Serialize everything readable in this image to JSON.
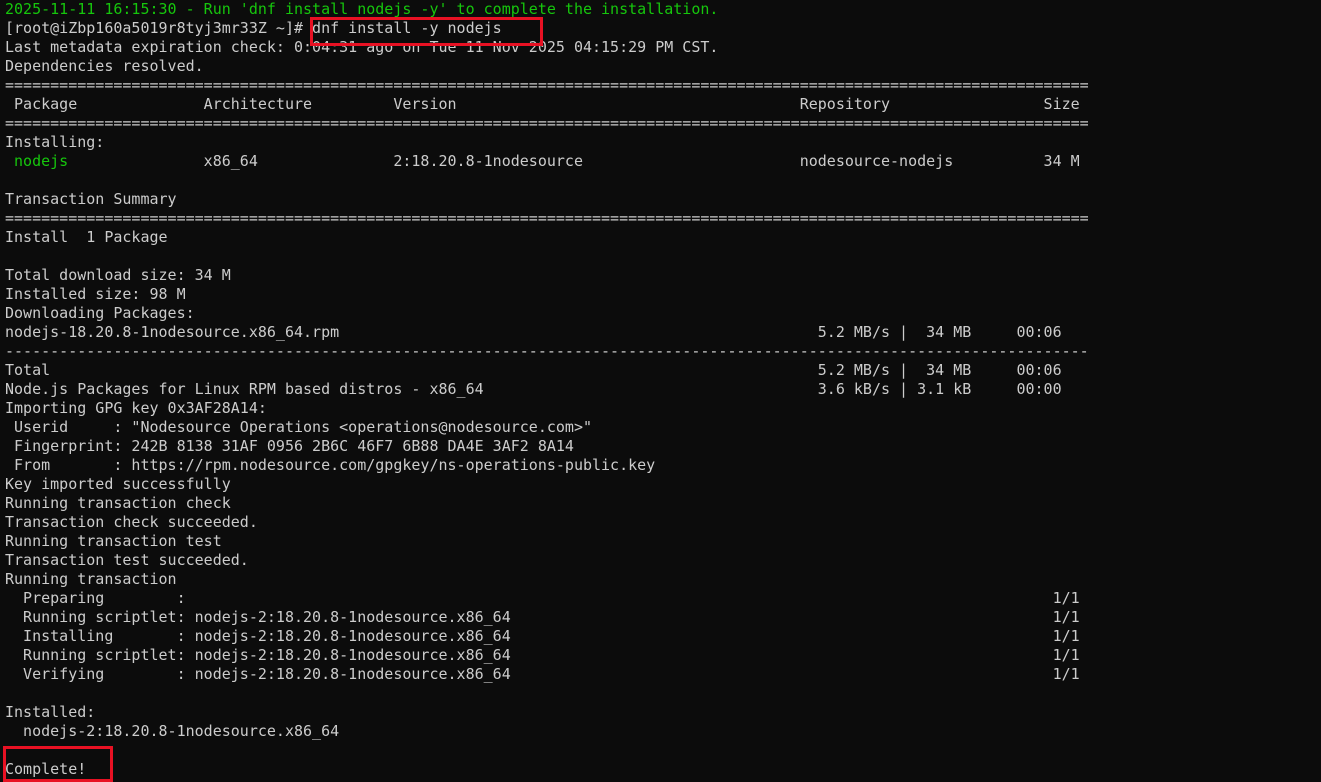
{
  "colors": {
    "background": "#0c0c0c",
    "foreground": "#cccccc",
    "green": "#16c60c",
    "annotation_red": "#e81123"
  },
  "lines": [
    [
      {
        "t": "2025-11-11 16:15:30 - Run 'dnf install nodejs -y' to complete the installation.",
        "c": "green-cmd"
      }
    ],
    [
      {
        "t": "[root@iZbp160a5019r8tyj3mr33Z ~]# "
      },
      {
        "t": "dnf install -y nodejs"
      }
    ],
    [
      {
        "t": "Last metadata expiration check: 0:04:31 ago on Tue 11 Nov 2025 04:15:29 PM CST."
      }
    ],
    [
      {
        "t": "Dependencies resolved."
      }
    ],
    [
      {
        "t": "========================================================================================================================"
      }
    ],
    [
      {
        "t": " Package              Architecture         Version                                      Repository                 Size"
      }
    ],
    [
      {
        "t": "========================================================================================================================"
      }
    ],
    [
      {
        "t": "Installing:"
      }
    ],
    [
      {
        "t": " "
      },
      {
        "t": "nodejs",
        "c": "green-pkg"
      },
      {
        "t": "               x86_64               2:18.20.8-1nodesource                        nodesource-nodejs          34 M"
      }
    ],
    [
      {
        "t": ""
      }
    ],
    [
      {
        "t": "Transaction Summary"
      }
    ],
    [
      {
        "t": "========================================================================================================================"
      }
    ],
    [
      {
        "t": "Install  1 Package"
      }
    ],
    [
      {
        "t": ""
      }
    ],
    [
      {
        "t": "Total download size: 34 M"
      }
    ],
    [
      {
        "t": "Installed size: 98 M"
      }
    ],
    [
      {
        "t": "Downloading Packages:"
      }
    ],
    [
      {
        "t": "nodejs-18.20.8-1nodesource.x86_64.rpm                                                     5.2 MB/s |  34 MB     00:06"
      }
    ],
    [
      {
        "t": "------------------------------------------------------------------------------------------------------------------------"
      }
    ],
    [
      {
        "t": "Total                                                                                     5.2 MB/s |  34 MB     00:06"
      }
    ],
    [
      {
        "t": "Node.js Packages for Linux RPM based distros - x86_64                                     3.6 kB/s | 3.1 kB     00:00"
      }
    ],
    [
      {
        "t": "Importing GPG key 0x3AF28A14:"
      }
    ],
    [
      {
        "t": " Userid     : \"Nodesource Operations <operations@nodesource.com>\""
      }
    ],
    [
      {
        "t": " Fingerprint: 242B 8138 31AF 0956 2B6C 46F7 6B88 DA4E 3AF2 8A14"
      }
    ],
    [
      {
        "t": " From       : https://rpm.nodesource.com/gpgkey/ns-operations-public.key"
      }
    ],
    [
      {
        "t": "Key imported successfully"
      }
    ],
    [
      {
        "t": "Running transaction check"
      }
    ],
    [
      {
        "t": "Transaction check succeeded."
      }
    ],
    [
      {
        "t": "Running transaction test"
      }
    ],
    [
      {
        "t": "Transaction test succeeded."
      }
    ],
    [
      {
        "t": "Running transaction"
      }
    ],
    [
      {
        "t": "  Preparing        :                                                                                                1/1"
      }
    ],
    [
      {
        "t": "  Running scriptlet: nodejs-2:18.20.8-1nodesource.x86_64                                                            1/1"
      }
    ],
    [
      {
        "t": "  Installing       : nodejs-2:18.20.8-1nodesource.x86_64                                                            1/1"
      }
    ],
    [
      {
        "t": "  Running scriptlet: nodejs-2:18.20.8-1nodesource.x86_64                                                            1/1"
      }
    ],
    [
      {
        "t": "  Verifying        : nodejs-2:18.20.8-1nodesource.x86_64                                                            1/1"
      }
    ],
    [
      {
        "t": ""
      }
    ],
    [
      {
        "t": "Installed:"
      }
    ],
    [
      {
        "t": "  nodejs-2:18.20.8-1nodesource.x86_64"
      }
    ],
    [
      {
        "t": ""
      }
    ],
    [
      {
        "t": "Complete!"
      }
    ]
  ]
}
